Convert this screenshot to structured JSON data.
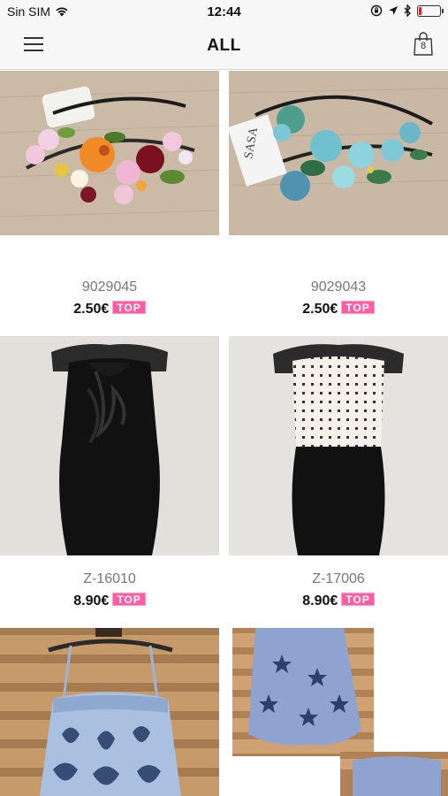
{
  "status_bar": {
    "carrier": "Sin SIM",
    "time": "12:44",
    "battery_level": 0.12,
    "battery_color": "#e02020"
  },
  "nav": {
    "title": "ALL",
    "menu_icon": "hamburger-menu-icon",
    "cart_icon": "shopping-bag-icon",
    "cart_count": "8"
  },
  "products": [
    {
      "code": "9029045",
      "price": "2.50€",
      "badge": "TOP",
      "image": "floral-headband-pink-orange"
    },
    {
      "code": "9029043",
      "price": "2.50€",
      "badge": "TOP",
      "image": "floral-headband-blue"
    },
    {
      "code": "Z-16010",
      "price": "8.90€",
      "badge": "TOP",
      "image": "black-ruffle-halter-dress"
    },
    {
      "code": "Z-17006",
      "price": "8.90€",
      "badge": "TOP",
      "image": "white-dotted-top-black-skirt-dress"
    },
    {
      "code": "",
      "price": "",
      "badge": "",
      "image": "blue-embroidered-camisole-top"
    },
    {
      "code": "",
      "price": "",
      "badge": "",
      "image": "blue-star-print-top"
    }
  ],
  "colors": {
    "badge": "#ff5da2",
    "bar_background": "#f7f7f7"
  }
}
